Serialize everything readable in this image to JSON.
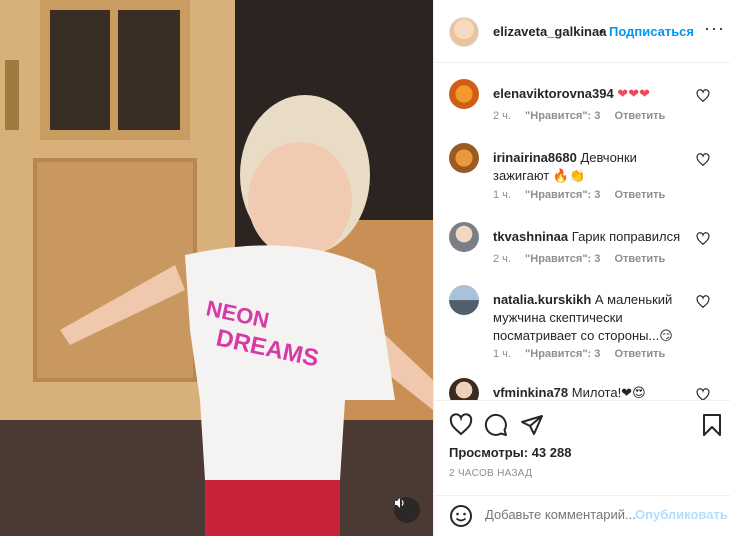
{
  "header": {
    "username": "elizaveta_galkinaa",
    "dot": "•",
    "follow_label": "Подписаться",
    "more_label": "···"
  },
  "comments": [
    {
      "username": "elenaviktorovna394",
      "text": " ❤❤❤",
      "time": "2 ч.",
      "likes": "\"Нравится\": 3",
      "reply": "Ответить"
    },
    {
      "username": "irinairina8680",
      "text": " Девчонки зажигают 🔥👏",
      "time": "1 ч.",
      "likes": "\"Нравится\": 3",
      "reply": "Ответить"
    },
    {
      "username": "tkvashninaa",
      "text": " Гарик поправился",
      "time": "2 ч.",
      "likes": "\"Нравится\": 3",
      "reply": "Ответить"
    },
    {
      "username": "natalia.kurskikh",
      "text": " А маленький мужчина скептически посматривает со стороны...😏",
      "time": "1 ч.",
      "likes": "\"Нравится\": 3",
      "reply": "Ответить"
    },
    {
      "username": "vfminkina78",
      "text": " Милота!❤😍",
      "time": "",
      "likes": "",
      "reply": ""
    }
  ],
  "stats": {
    "views": "Просмотры: 43 288",
    "time_ago": "2 ЧАСОВ НАЗАД"
  },
  "add_comment": {
    "placeholder": "Добавьте комментарий...",
    "publish_label": "Опубликовать"
  },
  "colors": {
    "accent": "#0095f6",
    "publish_disabled": "#b2dffc",
    "muted": "#8e8e8e",
    "text": "#262626"
  },
  "icons": {
    "like": "heart-icon",
    "comment": "comment-icon",
    "share": "paper-plane-icon",
    "save": "bookmark-icon",
    "emoji": "smiley-icon",
    "sound": "speaker-icon"
  }
}
